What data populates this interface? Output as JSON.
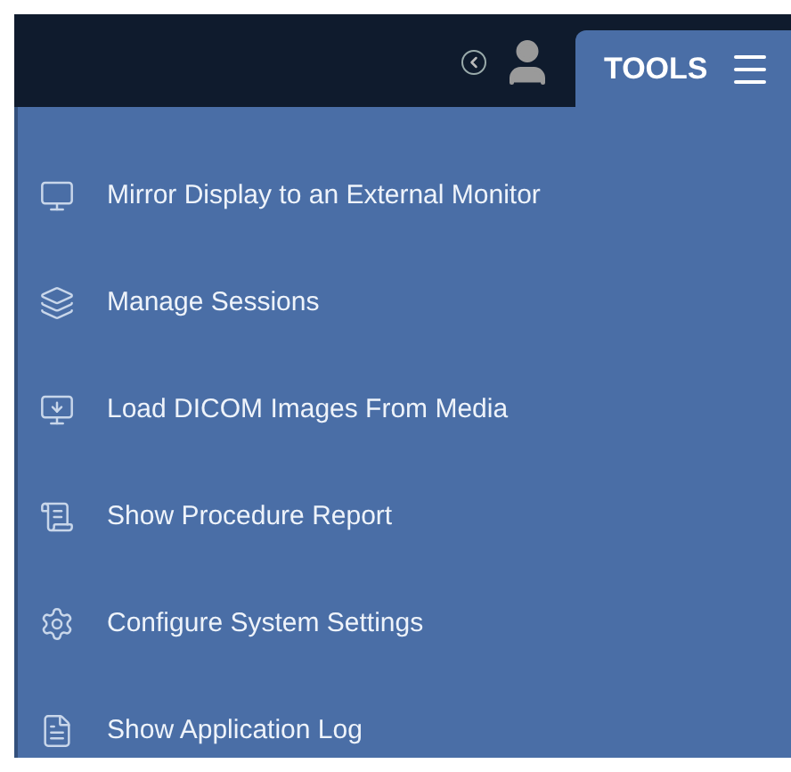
{
  "tab": {
    "label": "TOOLS",
    "selected": true
  },
  "menu_items": [
    {
      "kind": "mirror",
      "label": "Mirror Display to an External Monitor"
    },
    {
      "kind": "sessions",
      "label": "Manage Sessions"
    },
    {
      "kind": "load",
      "label": "Load DICOM Images From Media"
    },
    {
      "kind": "report",
      "label": "Show Procedure Report"
    },
    {
      "kind": "settings",
      "label": "Configure System Settings"
    },
    {
      "kind": "log",
      "label": "Show Application Log"
    }
  ]
}
